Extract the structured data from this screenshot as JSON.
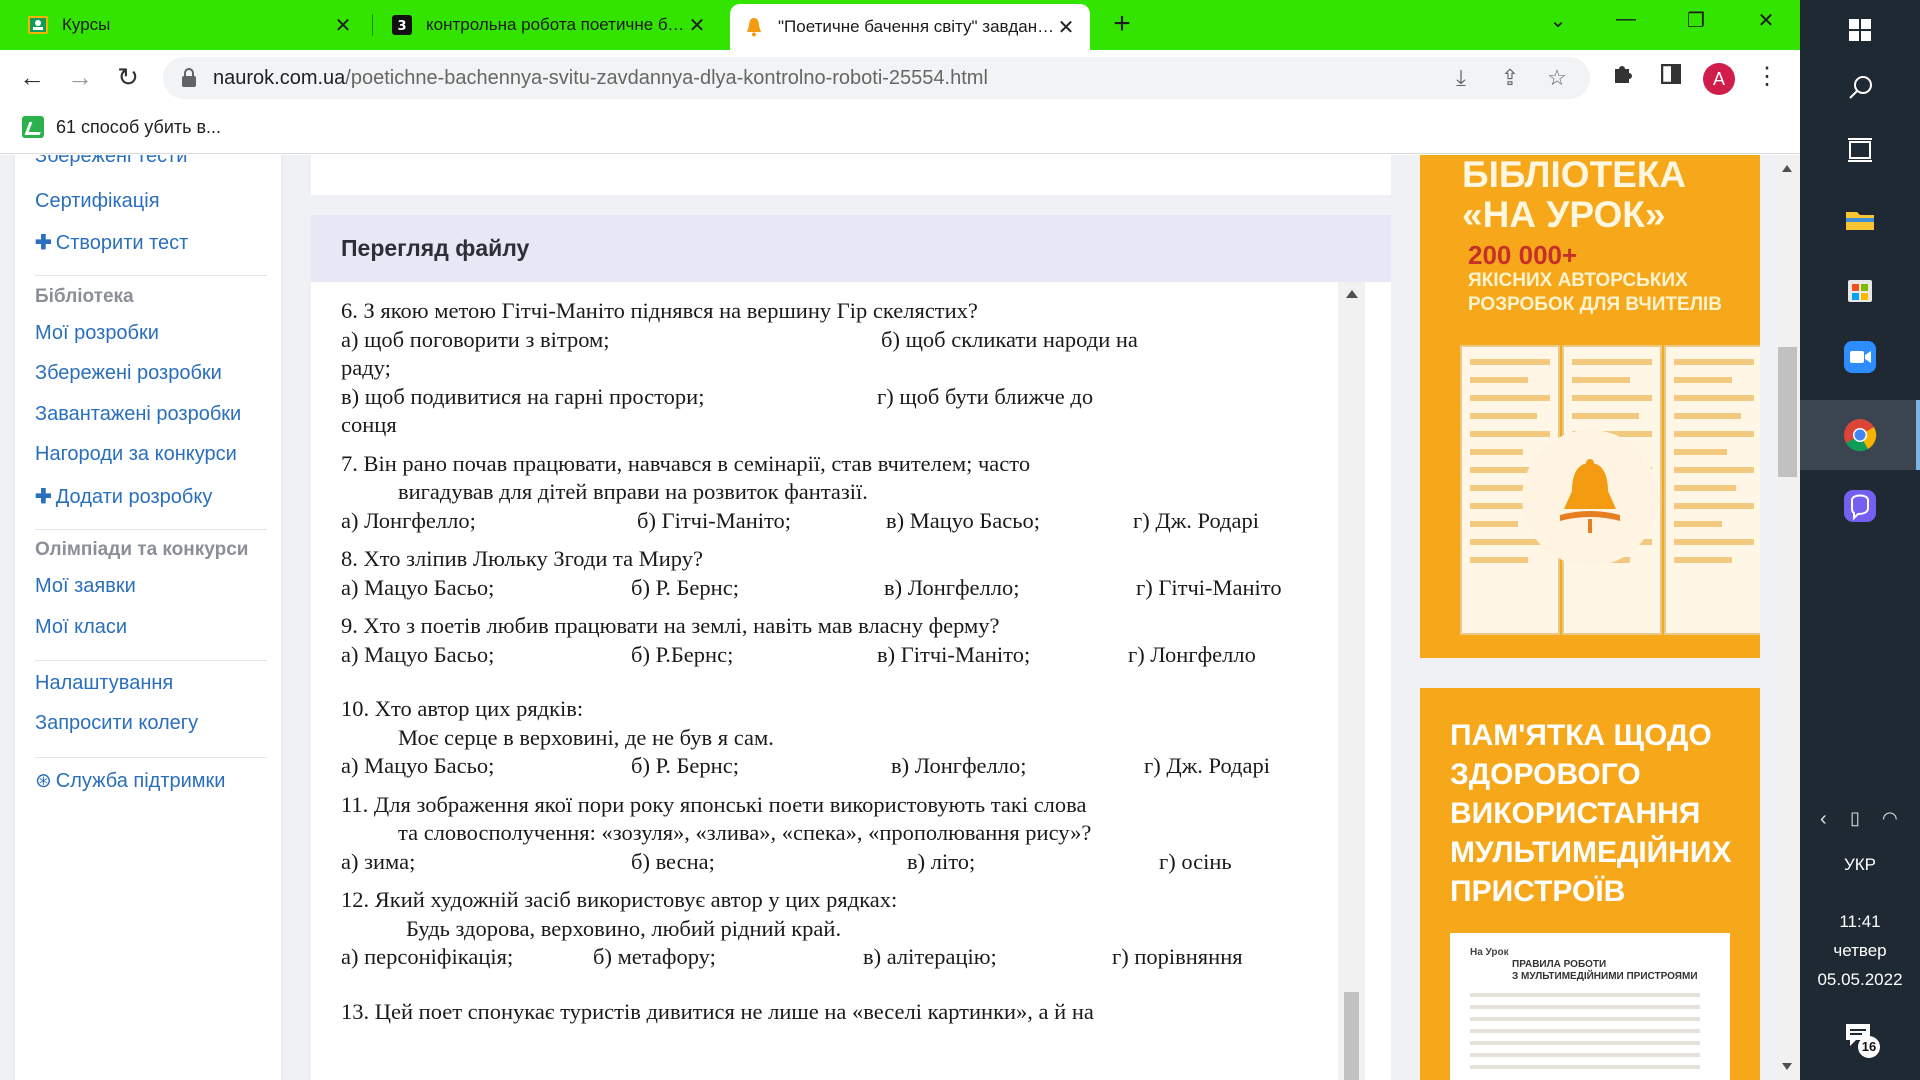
{
  "browser": {
    "tabs": [
      {
        "title": "Курсы",
        "active": false
      },
      {
        "title": "контрольна робота поетичне бачення світу",
        "active": false
      },
      {
        "title": "\"Поетичне бачення світу\" завдання для контрольної роботи",
        "active": true
      }
    ],
    "url_host": "naurok.com.ua",
    "url_path": "/poetichne-bachennya-svitu-zavdannya-dlya-kontrolno-roboti-25554.html",
    "bookmark": "61 способ убить в...",
    "profile_initial": "A",
    "tabstrip_color": "#33e400"
  },
  "sidebar": {
    "partial_top": "Збережені тести",
    "cert": "Сертифікація",
    "create_test": "Створити тест",
    "library_head": "Бібліотека",
    "my_dev": "Мої розробки",
    "saved_dev": "Збережені розробки",
    "uploaded_dev": "Завантажені розробки",
    "awards": "Нагороди за конкурси",
    "add_dev": "Додати розробку",
    "olymp_head": "Олімпіади та конкурси",
    "my_apps": "Мої заявки",
    "my_classes": "Мої класи",
    "settings": "Налаштування",
    "invite": "Запросити колегу",
    "support": "Служба підтримки"
  },
  "viewer": {
    "heading": "Перегляд файлу",
    "lines": {
      "q6": "6. З якою метою Гітчі-Маніто піднявся на вершину Гір скелястих?",
      "q6a": "а) щоб поговорити з вітром;",
      "q6b": "б) щоб скликати народи на",
      "q6b2": "раду;",
      "q6c": "в) щоб подивитися на гарні простори;",
      "q6d": "г) щоб бути ближче до",
      "q6d2": "сонця",
      "q7": "7.  Він рано почав працювати, навчався в семінарії, став вчителем; часто",
      "q7b": "вигадував для дітей вправи на розвиток фантазії.",
      "q7o1": "а) Лонгфелло;",
      "q7o2": "б) Гітчі-Маніто;",
      "q7o3": "в) Мацуо Басьо;",
      "q7o4": "г) Дж. Родарі",
      "q8": "8. Хто зліпив Люльку Згоди та Миру?",
      "q8o1": "а) Мацуо Басьо;",
      "q8o2": "б) Р. Бернс;",
      "q8o3": "в) Лонгфелло;",
      "q8o4": "г) Гітчі-Маніто",
      "q9": "9. Хто з поетів любив працювати на землі, навіть мав власну ферму?",
      "q9o1": "а) Мацуо Басьо;",
      "q9o2": "б) Р.Бернс;",
      "q9o3": "в) Гітчі-Маніто;",
      "q9o4": "г) Лонгфелло",
      "q10": "10. Хто автор цих рядків:",
      "q10b": "Моє серце в верховині, де не був я сам.",
      "q10o1": "а) Мацуо Басьо;",
      "q10o2": "б) Р. Бернс;",
      "q10o3": "в) Лонгфелло;",
      "q10o4": "г) Дж. Родарі",
      "q11": "11. Для зображення  якої  пори року японські поети використовують такі слова",
      "q11b": "та словосполучення: «зозуля», «злива», «спека», «прополювання рису»?",
      "q11o1": "а) зима;",
      "q11o2": "б) весна;",
      "q11o3": "в) літо;",
      "q11o4": "г) осінь",
      "q12": "12. Який художній засіб використовує автор у цих рядках:",
      "q12b": "Будь здорова, верховино, любий рідний край.",
      "q12o1": "а) персоніфікація;",
      "q12o2": "б) метафору;",
      "q12o3": "в) алітерацію;",
      "q12o4": "г) порівняння",
      "q13": "13. Цей поет спонукає туристів дивитися не лише на «веселі картинки», а й на"
    }
  },
  "ads": {
    "ad1_title1": "БІБЛІОТЕКА",
    "ad1_title2": "«НА УРОК»",
    "ad1_num": "200 000+",
    "ad1_sub1": "ЯКІСНИХ АВТОРСЬКИХ",
    "ad1_sub2": "РОЗРОБОК ДЛЯ ВЧИТЕЛІВ",
    "ad2_l1": "ПАМ'ЯТКА ЩОДО",
    "ad2_l2": "ЗДОРОВОГО",
    "ad2_l3": "ВИКОРИСТАННЯ",
    "ad2_l4": "МУЛЬТИМЕДІЙНИХ",
    "ad2_l5": "ПРИСТРОЇВ",
    "ad2_logo": "На Урок",
    "ad2_sheet1": "ПРАВИЛА РОБОТИ",
    "ad2_sheet2": "З МУЛЬТИМЕДІЙНИМИ ПРИСТРОЯМИ",
    "accent": "#f6a81a"
  },
  "taskbar": {
    "lang": "УКР",
    "time": "11:41",
    "day": "четвер",
    "date": "05.05.2022",
    "notifications": "16"
  }
}
